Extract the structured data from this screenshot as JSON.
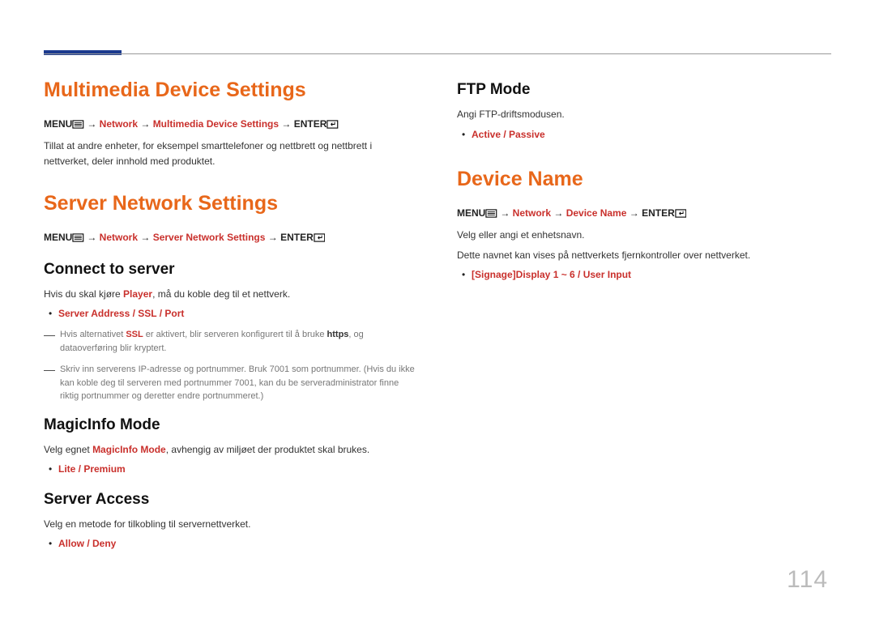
{
  "page_number": "114",
  "left": {
    "h1a": "Multimedia Device Settings",
    "nav_a": {
      "menu": "MENU",
      "arrow": " → ",
      "p1": "Network",
      "p2": "Multimedia Device Settings",
      "enter": "ENTER"
    },
    "body_a": "Tillat at andre enheter, for eksempel smarttelefoner og nettbrett og nettbrett i nettverket, deler innhold med produktet.",
    "h1b": "Server Network Settings",
    "nav_b": {
      "menu": "MENU",
      "arrow": " → ",
      "p1": "Network",
      "p2": "Server Network Settings",
      "enter": "ENTER"
    },
    "h2_connect": "Connect to server",
    "connect_body_pre": "Hvis du skal kjøre ",
    "connect_body_hot": "Player",
    "connect_body_post": ", må du koble deg til et nettverk.",
    "connect_bullet": "Server Address / SSL / Port",
    "connect_note": {
      "pre": "Hvis alternativet ",
      "hot1": "SSL",
      "mid": " er aktivert, blir serveren konfigurert til å bruke ",
      "https": "https",
      "post": ", og dataoverføring blir kryptert."
    },
    "connect_dash_note": "Skriv inn serverens IP-adresse og portnummer. Bruk 7001 som portnummer. (Hvis du ikke kan koble deg til serveren med portnummer 7001, kan du be serveradministrator finne riktig portnummer og deretter endre portnummeret.)",
    "h2_magic": "MagicInfo Mode",
    "magic_body_pre": "Velg egnet ",
    "magic_body_hot": "MagicInfo Mode",
    "magic_body_post": ", avhengig av miljøet der produktet skal brukes.",
    "magic_bullet": "Lite / Premium",
    "h2_access": "Server Access",
    "access_body": "Velg en metode for tilkobling til servernettverket.",
    "access_bullet": "Allow / Deny"
  },
  "right": {
    "h2_ftp": "FTP Mode",
    "ftp_body": "Angi FTP-driftsmodusen.",
    "ftp_bullet": "Active / Passive",
    "h1_dev": "Device Name",
    "nav_dev": {
      "menu": "MENU",
      "arrow": " → ",
      "p1": "Network",
      "p2": "Device Name",
      "enter": "ENTER"
    },
    "dev_body1": "Velg eller angi et enhetsnavn.",
    "dev_body2": "Dette navnet kan vises på nettverkets fjernkontroller over nettverket.",
    "dev_bullet": "[Signage]Display 1 ~ 6 / User Input"
  }
}
